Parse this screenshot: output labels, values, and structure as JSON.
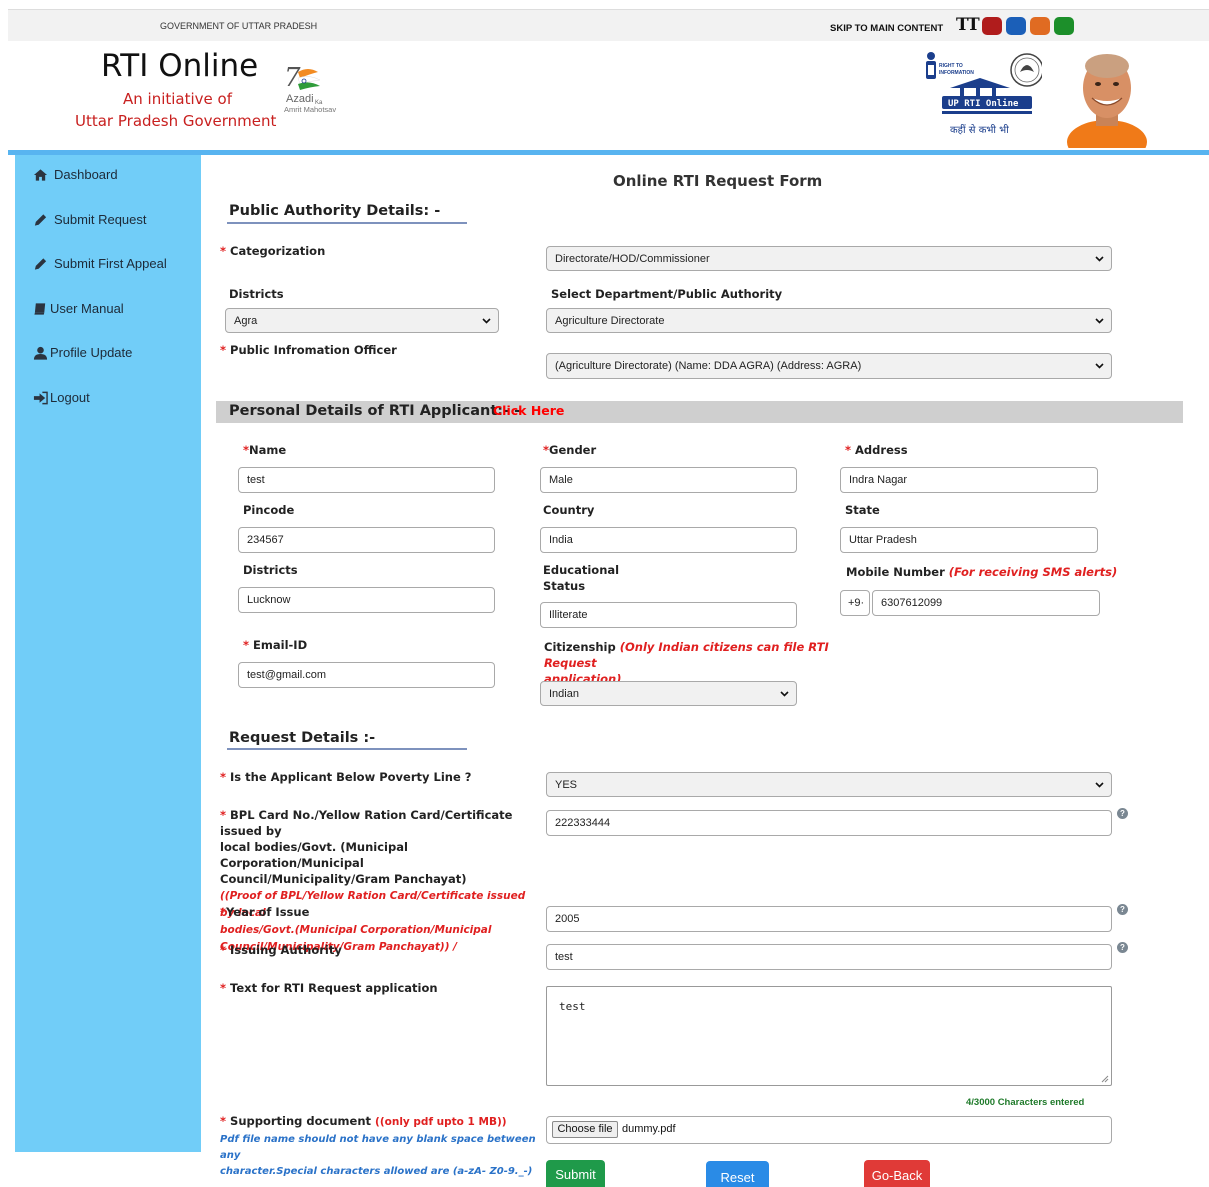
{
  "topbar": {
    "gov_name": "GOVERNMENT OF UTTAR PRADESH",
    "skip_link": "SKIP TO MAIN CONTENT",
    "text_size": "TT",
    "themes": [
      "#b01c1c",
      "#1b5fb8",
      "#e06b22",
      "#1c8f2a"
    ]
  },
  "header": {
    "title": "RTI Online",
    "subtitle_line1": "An initiative of",
    "subtitle_line2": "Uttar Pradesh Government",
    "azadi_line1": "Azadi",
    "azadi_ka": "Ka",
    "azadi_line2": "Amrit Mahotsav",
    "rti_logo_line1": "RIGHT TO",
    "rti_logo_line2": "INFORMATION",
    "rti_logo_banner": "UP RTI Online",
    "rti_logo_tagline": "कहीं से कभी भी"
  },
  "sidebar": {
    "items": [
      {
        "label": "Dashboard",
        "icon": "home-icon"
      },
      {
        "label": "Submit Request",
        "icon": "pencil-icon"
      },
      {
        "label": "Submit First Appeal",
        "icon": "pencil-icon"
      },
      {
        "label": "User Manual",
        "icon": "book-icon"
      },
      {
        "label": "Profile Update",
        "icon": "user-icon"
      },
      {
        "label": "Logout",
        "icon": "logout-icon"
      }
    ]
  },
  "form": {
    "title": "Online RTI Request Form",
    "public_authority": {
      "heading": "Public Authority Details: -",
      "categorization_label": "Categorization",
      "categorization_value": "Directorate/HOD/Commissioner",
      "districts_label": "Districts",
      "districts_value": "Agra",
      "department_label": "Select Department/Public Authority",
      "department_value": "Agriculture Directorate",
      "pio_label": "Public Infromation Officer",
      "pio_value": "(Agriculture Directorate) (Name: DDA AGRA) (Address: AGRA)"
    },
    "personal": {
      "heading": "Personal Details of RTI Applicant:- -",
      "click_here": "Click Here",
      "name_label": "Name",
      "name_value": "test",
      "gender_label": "Gender",
      "gender_value": "Male",
      "address_label": "Address",
      "address_value": "Indra Nagar",
      "pincode_label": "Pincode",
      "pincode_value": "234567",
      "country_label": "Country",
      "country_value": "India",
      "state_label": "State",
      "state_value": "Uttar Pradesh",
      "districts_label": "Districts",
      "districts_value": "Lucknow",
      "education_label_1": "Educational",
      "education_label_2": "Status",
      "education_value": "Illiterate",
      "mobile_label": "Mobile Number",
      "mobile_note": "(For receiving SMS alerts)",
      "mobile_code": "+9·",
      "mobile_value": "6307612099",
      "email_label": "Email-ID",
      "email_value": "test@gmail.com",
      "citizenship_label": "Citizenship",
      "citizenship_note_1": "(Only Indian citizens can file RTI Request",
      "citizenship_note_2": "application)",
      "citizenship_value": "Indian"
    },
    "request": {
      "heading": "Request Details :-",
      "bpl_label": "Is the Applicant Below Poverty Line ?",
      "bpl_value": "YES",
      "card_label_1": "BPL Card No./Yellow Ration Card/Certificate issued by",
      "card_label_2": "local bodies/Govt. (Municipal Corporation/Municipal",
      "card_label_3": "Council/Municipality/Gram Panchayat)",
      "card_note_1": "((Proof of BPL/Yellow Ration Card/Certificate issued by local",
      "card_note_2": "bodies/Govt.(Municipal Corporation/Municipal",
      "card_note_3": "Council/Municipality/Gram Panchayat)) /",
      "card_value": "222333444",
      "year_label": "Year of Issue",
      "year_value": "2005",
      "authority_label": "Issuing Authority",
      "authority_value": "test",
      "text_label": "Text for RTI Request application",
      "text_value": "test",
      "char_count": "4/3000 Characters entered",
      "doc_label": "Supporting document",
      "doc_note": "((only pdf upto 1 MB))",
      "doc_hint_1": "Pdf file name should not have any blank space between any",
      "doc_hint_2": "character.Special characters allowed are (a-zA- Z0-9._-)",
      "choose_file": "Choose file",
      "file_name": "dummy.pdf"
    },
    "buttons": {
      "submit": "Submit",
      "reset": "Reset",
      "go_back": "Go-Back"
    }
  }
}
